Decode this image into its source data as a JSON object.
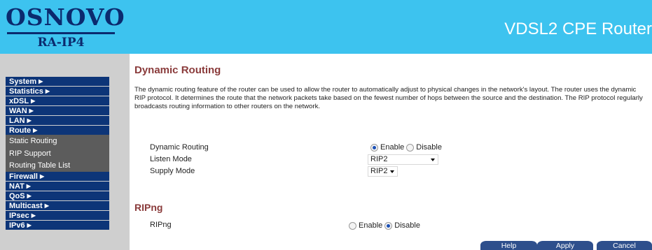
{
  "header": {
    "logo_main": "OSNOVO",
    "logo_sub": "RA-IP4",
    "product": "VDSL2 CPE Router"
  },
  "menu": [
    {
      "label": "System",
      "arrow": "▶"
    },
    {
      "label": "Statistics",
      "arrow": "▶"
    },
    {
      "label": "xDSL",
      "arrow": "▶"
    },
    {
      "label": "WAN",
      "arrow": "▶"
    },
    {
      "label": "LAN",
      "arrow": "▶"
    },
    {
      "label": "Route",
      "arrow": "▶"
    },
    {
      "label": "Firewall",
      "arrow": "▶"
    },
    {
      "label": "NAT",
      "arrow": "▶"
    },
    {
      "label": "QoS",
      "arrow": "▶"
    },
    {
      "label": "Multicast",
      "arrow": "▶"
    },
    {
      "label": "IPsec",
      "arrow": "▶"
    },
    {
      "label": "IPv6",
      "arrow": "▶"
    }
  ],
  "route_submenu": [
    "Static Routing",
    "RIP Support",
    "Routing Table List"
  ],
  "content": {
    "title": "Dynamic Routing",
    "description": "The dynamic routing feature of the router can be used to allow the router to automatically adjust to physical changes in the network's layout. The router uses the dynamic RIP protocol. It determines the route that the network packets take based on the fewest number of hops between the source and the destination. The RIP protocol regularly broadcasts routing information to other routers on the network.",
    "dynamic_routing": {
      "label": "Dynamic Routing",
      "enable_label": "Enable",
      "disable_label": "Disable",
      "selected": "Enable"
    },
    "listen_mode": {
      "label": "Listen Mode",
      "value": "RIP2"
    },
    "supply_mode": {
      "label": "Supply Mode",
      "value": "RIP2"
    },
    "ripng_section_title": "RIPng",
    "ripng": {
      "label": "RIPng",
      "enable_label": "Enable",
      "disable_label": "Disable",
      "selected": "Disable"
    }
  },
  "buttons": {
    "help": "Help",
    "apply": "Apply",
    "cancel": "Cancel"
  },
  "colors": {
    "header_bg": "#3dc3ef",
    "logo": "#0b2a6e",
    "menu_bg": "#0d3578",
    "submenu_bg": "#5c5c5c",
    "sidebar_bg": "#cfcfcf",
    "title": "#8a3b3b",
    "button_bg": "#2e4f8c"
  }
}
